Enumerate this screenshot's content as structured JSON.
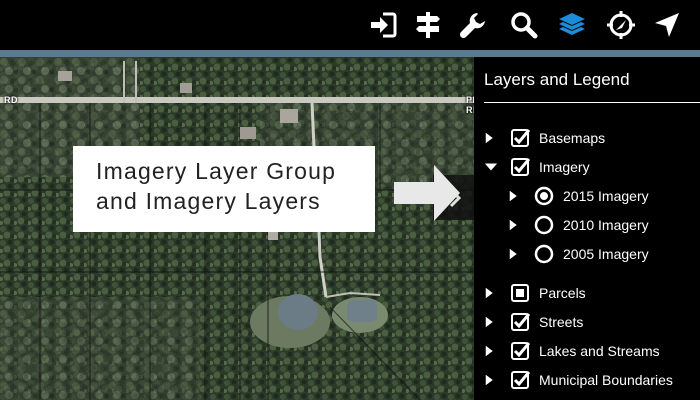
{
  "toolbar": {
    "icons": [
      "sign-in-icon",
      "signpost-icon",
      "wrench-icon",
      "search-icon",
      "layers-icon",
      "locate-icon",
      "navigate-icon"
    ],
    "active_color": "#1a8cd8"
  },
  "map": {
    "road_label_left": "RD",
    "road_label_right": "PETER RD"
  },
  "callout": {
    "line1": "Imagery Layer Group",
    "line2": "and Imagery Layers"
  },
  "panel": {
    "title": "Layers and Legend",
    "layers": [
      {
        "label": "Basemaps",
        "type": "checkbox",
        "state": "checked",
        "expanded": false
      },
      {
        "label": "Imagery",
        "type": "checkbox",
        "state": "checked",
        "expanded": true,
        "children": [
          {
            "label": "2015 Imagery",
            "type": "radio",
            "state": "selected"
          },
          {
            "label": "2010 Imagery",
            "type": "radio",
            "state": "unselected"
          },
          {
            "label": "2005 Imagery",
            "type": "radio",
            "state": "unselected"
          }
        ]
      },
      {
        "label": "Parcels",
        "type": "checkbox",
        "state": "partial",
        "expanded": false
      },
      {
        "label": "Streets",
        "type": "checkbox",
        "state": "checked",
        "expanded": false
      },
      {
        "label": "Lakes and Streams",
        "type": "checkbox",
        "state": "checked",
        "expanded": false
      },
      {
        "label": "Municipal Boundaries",
        "type": "checkbox",
        "state": "checked",
        "expanded": false
      }
    ]
  }
}
